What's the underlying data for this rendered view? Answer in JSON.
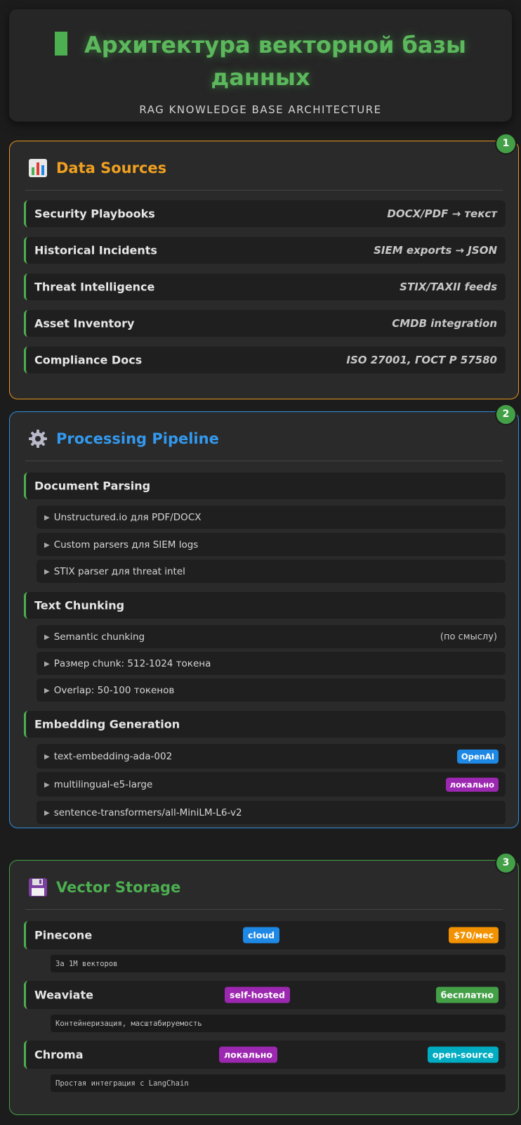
{
  "header": {
    "title_line1": "Архитектура векторной базы",
    "title_line2": "данных",
    "subtitle": "RAG KNOWLEDGE BASE ARCHITECTURE"
  },
  "sections": [
    {
      "number": "1",
      "icon": "bar-chart-icon",
      "title": "Data Sources",
      "accent": "#e8961e",
      "rows": [
        {
          "label": "Security Playbooks",
          "value": "DOCX/PDF → текст"
        },
        {
          "label": "Historical Incidents",
          "value": "SIEM exports → JSON"
        },
        {
          "label": "Threat Intelligence",
          "value": "STIX/TAXII feeds"
        },
        {
          "label": "Asset Inventory",
          "value": "CMDB integration"
        },
        {
          "label": "Compliance Docs",
          "value": "ISO 27001, ГОСТ Р 57580"
        }
      ]
    },
    {
      "number": "2",
      "icon": "gear-icon",
      "title": "Processing Pipeline",
      "accent": "#2f8fe0",
      "groups": [
        {
          "label": "Document Parsing",
          "items": [
            {
              "text": "Unstructured.io для PDF/DOCX"
            },
            {
              "text": "Custom parsers для SIEM logs"
            },
            {
              "text": "STIX parser для threat intel"
            }
          ]
        },
        {
          "label": "Text Chunking",
          "items": [
            {
              "text": "Semantic chunking",
              "note": "(по смыслу)"
            },
            {
              "text": "Размер chunk: 512-1024 токена"
            },
            {
              "text": "Overlap: 50-100 токенов"
            }
          ]
        },
        {
          "label": "Embedding Generation",
          "items": [
            {
              "text": "text-embedding-ada-002",
              "tag": "OpenAI",
              "tag_color": "#1e88e5"
            },
            {
              "text": "multilingual-e5-large",
              "tag": "локально",
              "tag_color": "#9c27b0"
            },
            {
              "text": "sentence-transformers/all-MiniLM-L6-v2"
            }
          ]
        }
      ]
    },
    {
      "number": "3",
      "icon": "floppy-disk-icon",
      "title": "Vector Storage",
      "accent": "#45a049",
      "stores": [
        {
          "name": "Pinecone",
          "tag1": "cloud",
          "tag1_color": "#1e88e5",
          "tag2": "$70/мес",
          "tag2_color": "#f39200",
          "note": "За 1M векторов"
        },
        {
          "name": "Weaviate",
          "tag1": "self-hosted",
          "tag1_color": "#9c27b0",
          "tag2": "бесплатно",
          "tag2_color": "#43a047",
          "note": "Контейнеризация, масштабируемость"
        },
        {
          "name": "Chroma",
          "tag1": "локально",
          "tag1_color": "#9c27b0",
          "tag2": "open-source",
          "tag2_color": "#00acc1",
          "note": "Простая интеграция с LangChain"
        }
      ]
    }
  ]
}
